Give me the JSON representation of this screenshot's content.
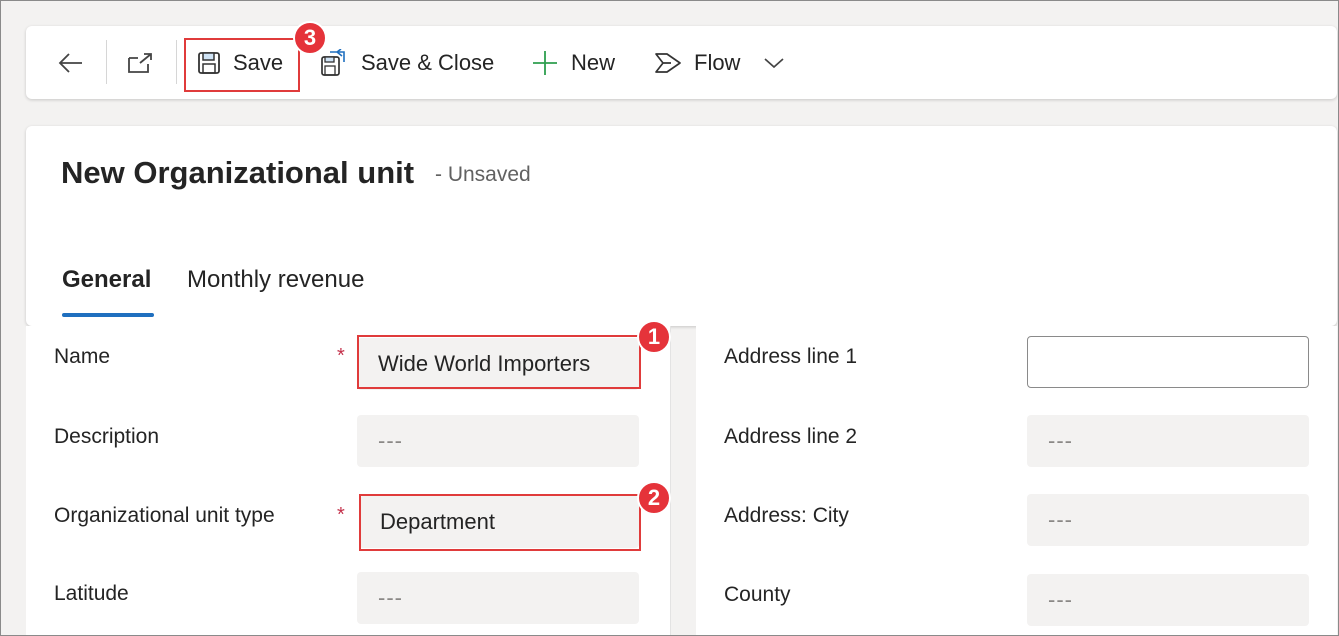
{
  "toolbar": {
    "back_icon": "arrow-left-icon",
    "popout_icon": "open-in-new-window-icon",
    "save_label": "Save",
    "save_close_label": "Save & Close",
    "new_label": "New",
    "flow_label": "Flow",
    "highlight_color": "#e03b3b"
  },
  "header": {
    "title": "New Organizational unit",
    "status": "- Unsaved"
  },
  "tabs": [
    {
      "label": "General",
      "active": true
    },
    {
      "label": "Monthly revenue",
      "active": false
    }
  ],
  "form_left": {
    "name": {
      "label": "Name",
      "required": "*",
      "value": "Wide World Importers"
    },
    "description": {
      "label": "Description",
      "value": "---"
    },
    "org_unit_type": {
      "label": "Organizational unit type",
      "required": "*",
      "value": "Department"
    },
    "latitude": {
      "label": "Latitude",
      "value": "---"
    }
  },
  "form_right": {
    "address_line_1": {
      "label": "Address line 1",
      "value": ""
    },
    "address_line_2": {
      "label": "Address line 2",
      "value": "---"
    },
    "city": {
      "label": "Address: City",
      "value": "---"
    },
    "county": {
      "label": "County",
      "value": "---"
    }
  },
  "callouts": {
    "one": "1",
    "two": "2",
    "three": "3",
    "color": "#e5333a"
  },
  "colors": {
    "accent": "#1f6fbf",
    "required": "#c4314b",
    "new_icon": "#2e9e4f"
  }
}
